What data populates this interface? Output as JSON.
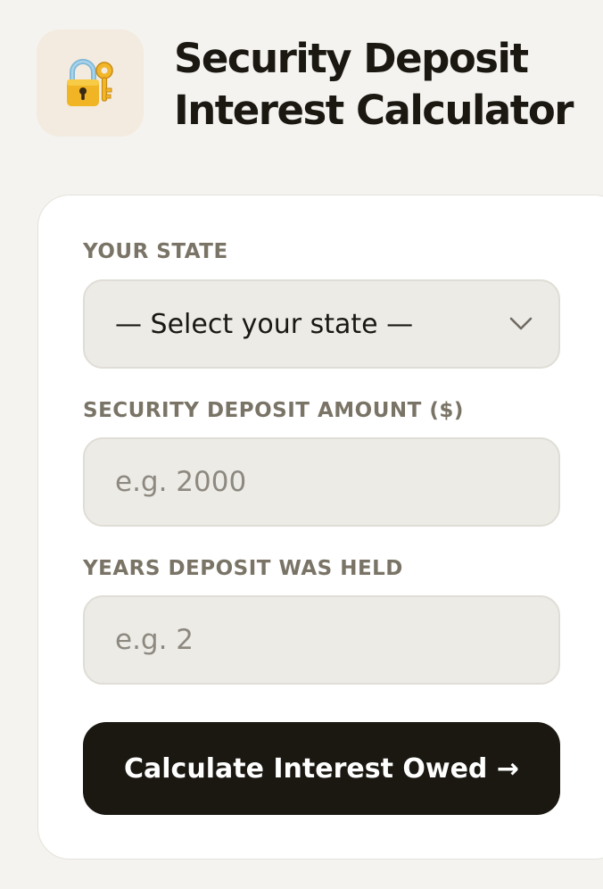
{
  "header": {
    "icon": "lock-with-key-icon",
    "title": "Security Deposit Interest Calculator"
  },
  "form": {
    "state": {
      "label": "YOUR STATE",
      "selected": "— Select your state —"
    },
    "amount": {
      "label": "SECURITY DEPOSIT AMOUNT ($)",
      "placeholder": "e.g. 2000",
      "value": ""
    },
    "years": {
      "label": "YEARS DEPOSIT WAS HELD",
      "placeholder": "e.g. 2",
      "value": ""
    },
    "submit_label": "Calculate Interest Owed →"
  },
  "colors": {
    "background": "#f4f3ef",
    "card": "#ffffff",
    "field": "#ecebe6",
    "label": "#7a7467",
    "button": "#1b1812",
    "icon_tile": "#f3ebdf"
  }
}
